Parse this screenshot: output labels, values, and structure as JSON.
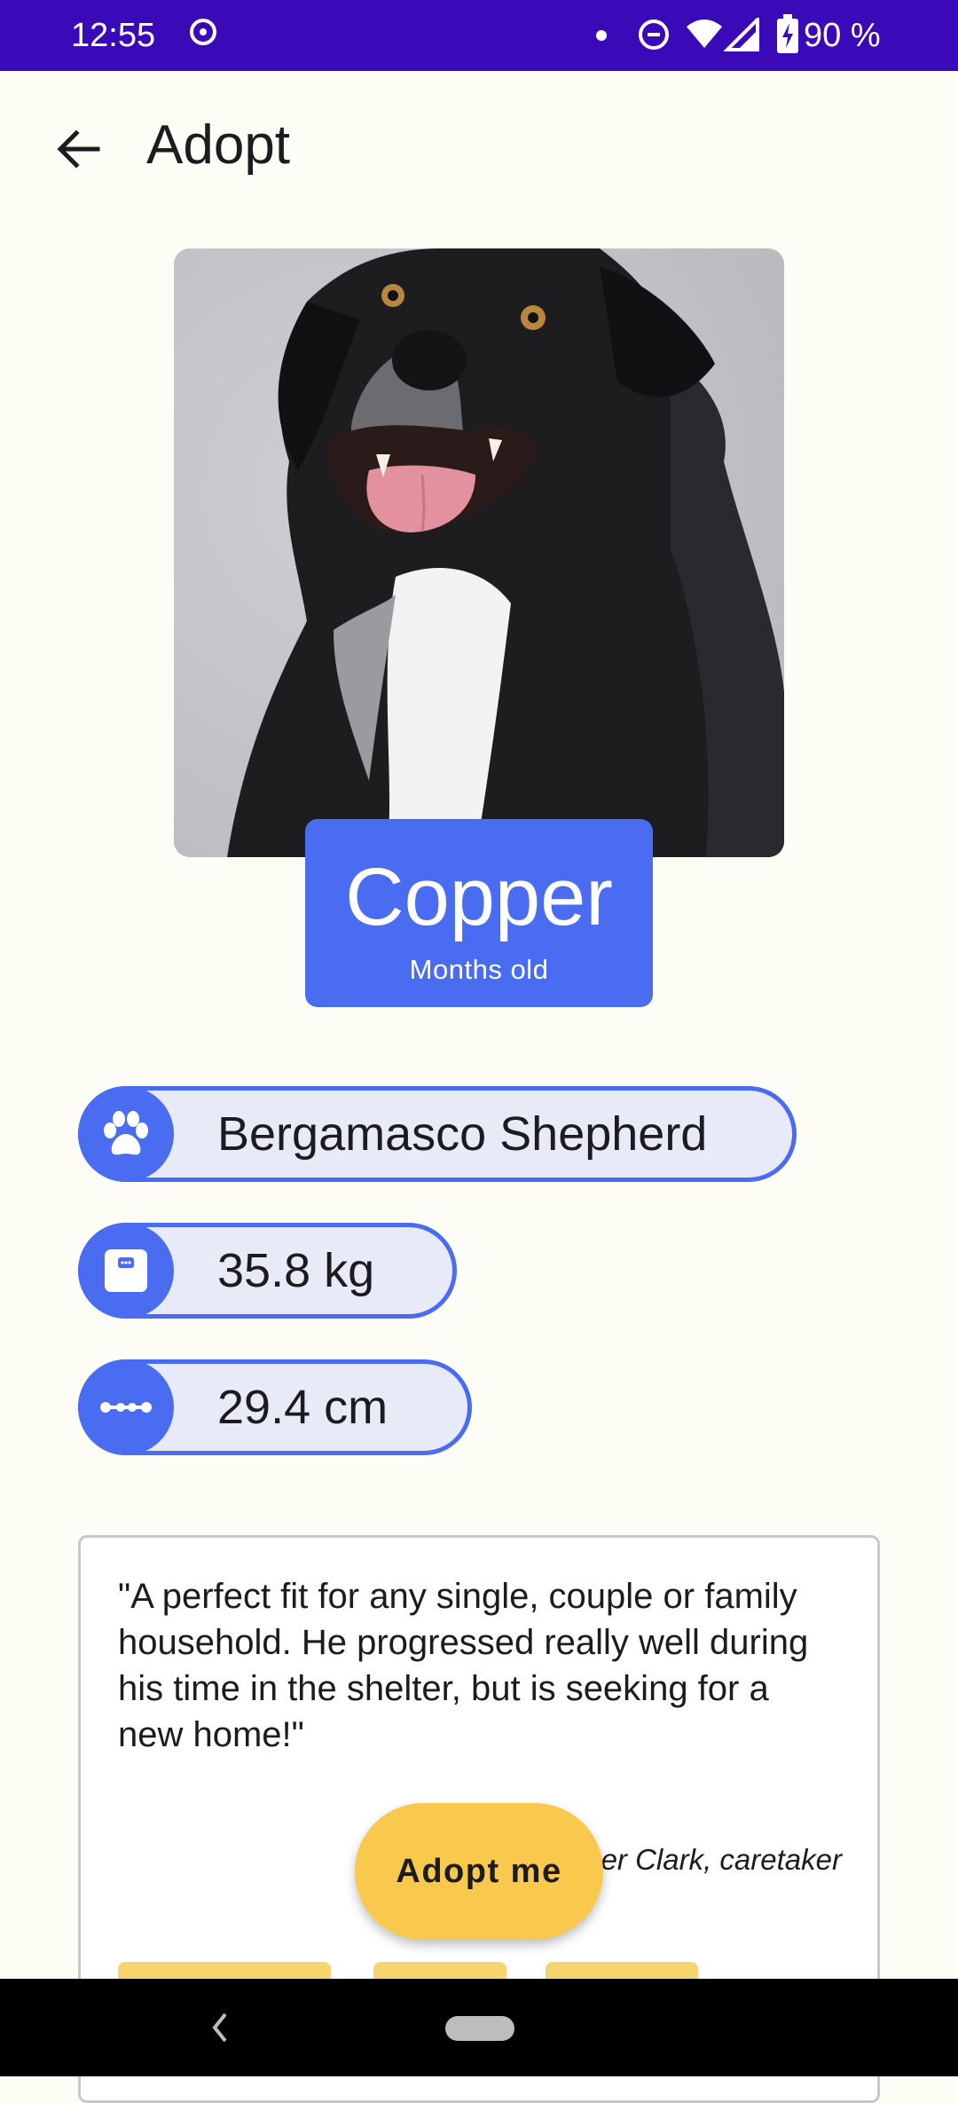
{
  "status_bar": {
    "time": "12:55",
    "battery_percent": "90 %",
    "icons": [
      "screen-record-icon",
      "notification-dot-icon",
      "do-not-disturb-icon",
      "wifi-icon",
      "signal-icon",
      "battery-charging-icon"
    ]
  },
  "app_bar": {
    "title": "Adopt",
    "back_icon": "arrow-back-icon"
  },
  "pet": {
    "name": "Copper",
    "age": "Months old",
    "breed": "Bergamasco Shepherd",
    "weight": "35.8 kg",
    "height": "29.4 cm",
    "photo": "black-and-white-dog-photo"
  },
  "chips": {
    "breed_icon": "paw-icon",
    "weight_icon": "scale-icon",
    "height_icon": "ruler-icon"
  },
  "quote": {
    "text": "\"A perfect fit for any single, couple or family household. He progressed really well during his time in the shelter, but is seeking for a new home!\"",
    "author_visible": "er Clark, caretaker"
  },
  "fab": {
    "label": "Adopt me"
  },
  "colors": {
    "status_bar": "#3A0AB8",
    "primary": "#4A6CF0",
    "chip_fill": "#E9EAF7",
    "fab": "#F9C94E",
    "background": "#FEFDF5"
  }
}
